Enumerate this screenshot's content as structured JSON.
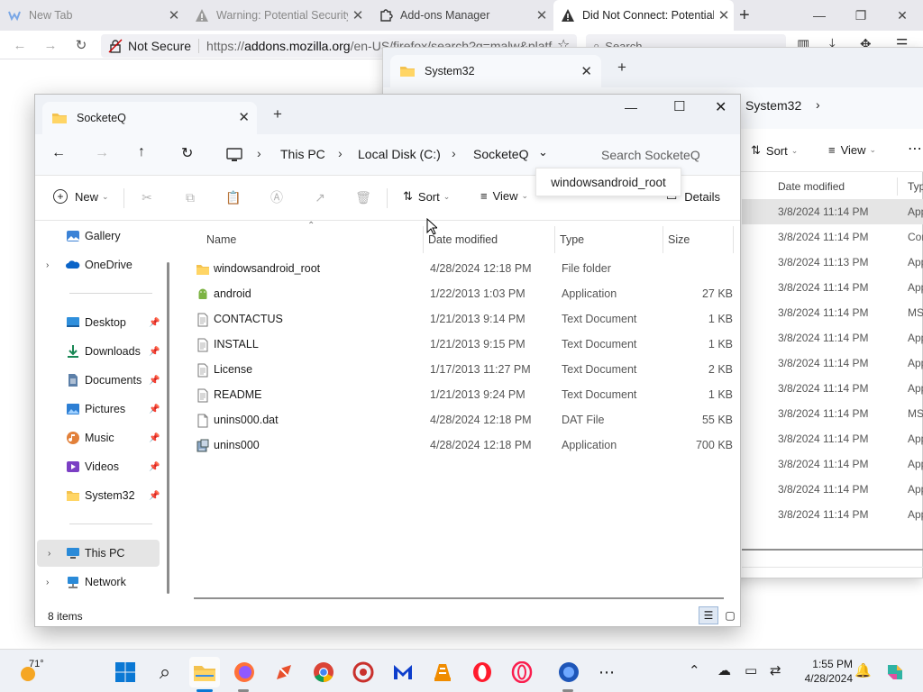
{
  "firefox": {
    "tabs": [
      {
        "title": "New Tab"
      },
      {
        "title": "Warning: Potential Security"
      },
      {
        "title": "Add-ons Manager"
      },
      {
        "title": "Did Not Connect: Potential"
      }
    ],
    "not_secure_label": "Not Secure",
    "url_prefix": "https://",
    "url_domain": "addons.mozilla.org",
    "url_rest": "/en-US/firefox/search?q=malw&platf",
    "search_placeholder": "Search"
  },
  "back_explorer": {
    "tab_title": "System32",
    "breadcrumb_current": "System32",
    "sort_label": "Sort",
    "view_label": "View",
    "col_date": "Date modified",
    "col_type": "Typ",
    "rows": [
      {
        "date": "3/8/2024 11:14 PM",
        "type": "App"
      },
      {
        "date": "3/8/2024 11:14 PM",
        "type": "Cor"
      },
      {
        "date": "3/8/2024 11:13 PM",
        "type": "App"
      },
      {
        "date": "3/8/2024 11:14 PM",
        "type": "App"
      },
      {
        "date": "3/8/2024 11:14 PM",
        "type": "MS"
      },
      {
        "date": "3/8/2024 11:14 PM",
        "type": "App"
      },
      {
        "date": "3/8/2024 11:14 PM",
        "type": "App"
      },
      {
        "date": "3/8/2024 11:14 PM",
        "type": "App"
      },
      {
        "date": "3/8/2024 11:14 PM",
        "type": "MS"
      },
      {
        "date": "3/8/2024 11:14 PM",
        "type": "App"
      },
      {
        "date": "3/8/2024 11:14 PM",
        "type": "App"
      },
      {
        "date": "3/8/2024 11:14 PM",
        "type": "App"
      },
      {
        "date": "3/8/2024 11:14 PM",
        "type": "App"
      }
    ]
  },
  "explorer": {
    "tab_title": "SocketeQ",
    "breadcrumb": [
      "This PC",
      "Local Disk (C:)",
      "SocketeQ"
    ],
    "search_placeholder": "Search SocketeQ",
    "toolbar": {
      "new": "New",
      "sort": "Sort",
      "view": "View",
      "details": "Details"
    },
    "nav": {
      "gallery": "Gallery",
      "onedrive": "OneDrive",
      "desktop": "Desktop",
      "downloads": "Downloads",
      "documents": "Documents",
      "pictures": "Pictures",
      "music": "Music",
      "videos": "Videos",
      "system32": "System32",
      "thispc": "This PC",
      "network": "Network"
    },
    "columns": {
      "name": "Name",
      "date": "Date modified",
      "type": "Type",
      "size": "Size"
    },
    "files": [
      {
        "name": "windowsandroid_root",
        "date": "4/28/2024 12:18 PM",
        "type": "File folder",
        "size": "",
        "icon": "folder-icon"
      },
      {
        "name": "android",
        "date": "1/22/2013 1:03 PM",
        "type": "Application",
        "size": "27 KB",
        "icon": "android-app-icon"
      },
      {
        "name": "CONTACTUS",
        "date": "1/21/2013 9:14 PM",
        "type": "Text Document",
        "size": "1 KB",
        "icon": "text-file-icon"
      },
      {
        "name": "INSTALL",
        "date": "1/21/2013 9:15 PM",
        "type": "Text Document",
        "size": "1 KB",
        "icon": "text-file-icon"
      },
      {
        "name": "License",
        "date": "1/17/2013 11:27 PM",
        "type": "Text Document",
        "size": "2 KB",
        "icon": "text-file-icon"
      },
      {
        "name": "README",
        "date": "1/21/2013 9:24 PM",
        "type": "Text Document",
        "size": "1 KB",
        "icon": "text-file-icon"
      },
      {
        "name": "unins000.dat",
        "date": "4/28/2024 12:18 PM",
        "type": "DAT File",
        "size": "55 KB",
        "icon": "dat-file-icon"
      },
      {
        "name": "unins000",
        "date": "4/28/2024 12:18 PM",
        "type": "Application",
        "size": "700 KB",
        "icon": "installer-icon"
      }
    ],
    "status": "8 items",
    "tooltip": "windowsandroid_root"
  },
  "taskbar": {
    "weather_temp": "71°",
    "time": "1:55 PM",
    "date": "4/28/2024"
  }
}
